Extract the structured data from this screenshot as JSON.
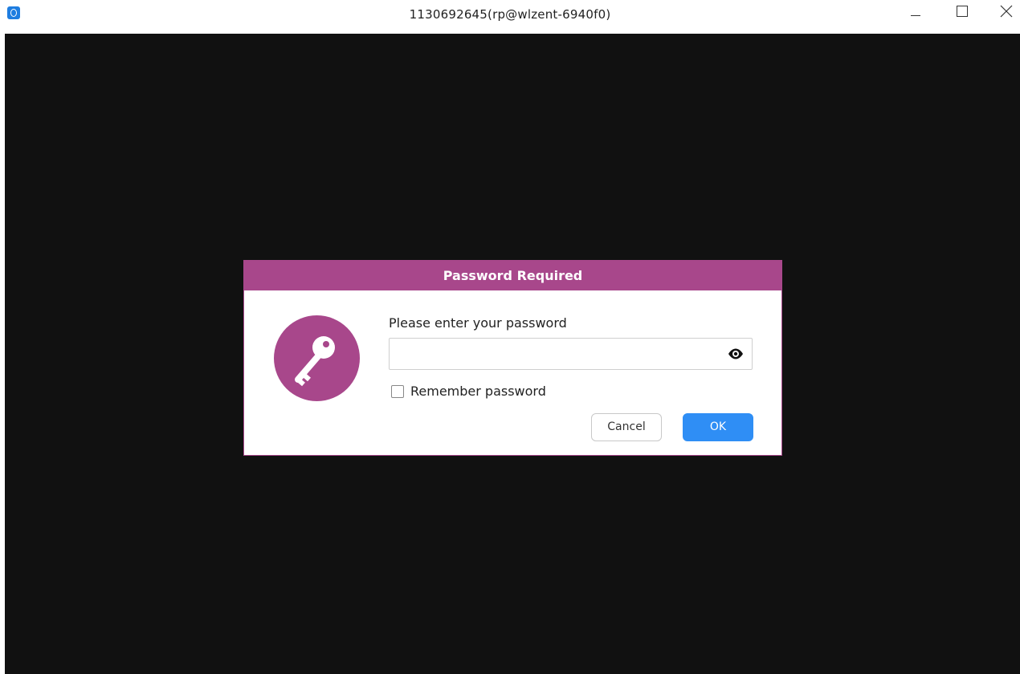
{
  "window": {
    "title": "1130692645(rp@wlzent-6940f0)",
    "app_icon": "remote-desktop-app-icon",
    "controls": [
      "minimize-icon",
      "maximize-icon",
      "close-icon"
    ]
  },
  "dialog": {
    "title": "Password Required",
    "icon": "key-icon",
    "prompt": "Please enter your password",
    "password_value": "",
    "reveal_icon": "eye-icon",
    "remember_label": "Remember password",
    "remember_checked": false,
    "cancel_label": "Cancel",
    "ok_label": "OK"
  },
  "colors": {
    "accent": "#a8478b",
    "primary_button": "#2f8ef5",
    "viewport_background": "#111111"
  }
}
